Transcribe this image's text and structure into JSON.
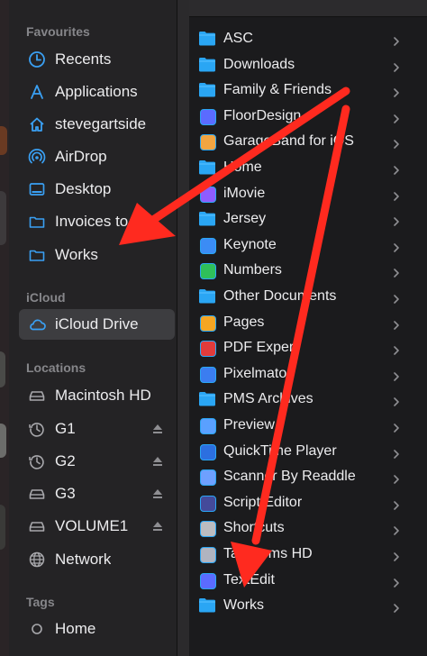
{
  "sidebar": {
    "sections": [
      {
        "label": "Favourites"
      },
      {
        "label": "iCloud"
      },
      {
        "label": "Locations"
      },
      {
        "label": "Tags"
      }
    ],
    "favourites": [
      {
        "label": "Recents",
        "icon": "clock-icon"
      },
      {
        "label": "Applications",
        "icon": "applications-icon"
      },
      {
        "label": "stevegartside",
        "icon": "home-icon"
      },
      {
        "label": "AirDrop",
        "icon": "airdrop-icon"
      },
      {
        "label": "Desktop",
        "icon": "desktop-icon"
      },
      {
        "label": "Invoices to",
        "icon": "folder-icon"
      },
      {
        "label": "Works",
        "icon": "folder-icon"
      }
    ],
    "icloud": [
      {
        "label": "iCloud Drive",
        "icon": "cloud-icon",
        "selected": true
      }
    ],
    "locations": [
      {
        "label": "Macintosh HD",
        "icon": "drive-icon"
      },
      {
        "label": "G1",
        "icon": "time-machine-icon",
        "eject": true
      },
      {
        "label": "G2",
        "icon": "time-machine-icon",
        "eject": true
      },
      {
        "label": "G3",
        "icon": "drive-icon",
        "eject": true
      },
      {
        "label": "VOLUME1",
        "icon": "drive-icon",
        "eject": true
      },
      {
        "label": "Network",
        "icon": "globe-icon"
      }
    ],
    "tags": [
      {
        "label": "Home",
        "icon": "tag-circle-icon"
      }
    ]
  },
  "files": [
    {
      "name": "ASC",
      "icon": "folder-icon"
    },
    {
      "name": "Downloads",
      "icon": "folder-icon"
    },
    {
      "name": "Family & Friends",
      "icon": "folder-icon"
    },
    {
      "name": "FloorDesign",
      "icon": "app-icon"
    },
    {
      "name": "GarageBand for iOS",
      "icon": "app-icon"
    },
    {
      "name": "Home",
      "icon": "folder-icon"
    },
    {
      "name": "iMovie",
      "icon": "app-icon"
    },
    {
      "name": "Jersey",
      "icon": "folder-icon"
    },
    {
      "name": "Keynote",
      "icon": "app-icon"
    },
    {
      "name": "Numbers",
      "icon": "app-icon"
    },
    {
      "name": "Other Documents",
      "icon": "folder-icon"
    },
    {
      "name": "Pages",
      "icon": "app-icon"
    },
    {
      "name": "PDF Expert",
      "icon": "app-icon"
    },
    {
      "name": "Pixelmator",
      "icon": "app-icon"
    },
    {
      "name": "PMS Archives",
      "icon": "folder-icon"
    },
    {
      "name": "Preview",
      "icon": "app-icon"
    },
    {
      "name": "QuickTime Player",
      "icon": "app-icon"
    },
    {
      "name": "Scanner By Readdle",
      "icon": "app-icon"
    },
    {
      "name": "Script Editor",
      "icon": "app-icon"
    },
    {
      "name": "Shortcuts",
      "icon": "app-icon"
    },
    {
      "name": "TapForms HD",
      "icon": "app-icon"
    },
    {
      "name": "TextEdit",
      "icon": "app-icon"
    },
    {
      "name": "Works",
      "icon": "folder-icon"
    }
  ],
  "colors": {
    "accent": "#3aa0f3",
    "annotation_arrow": "#ff2a1f",
    "folder": "#2aa6f4"
  }
}
